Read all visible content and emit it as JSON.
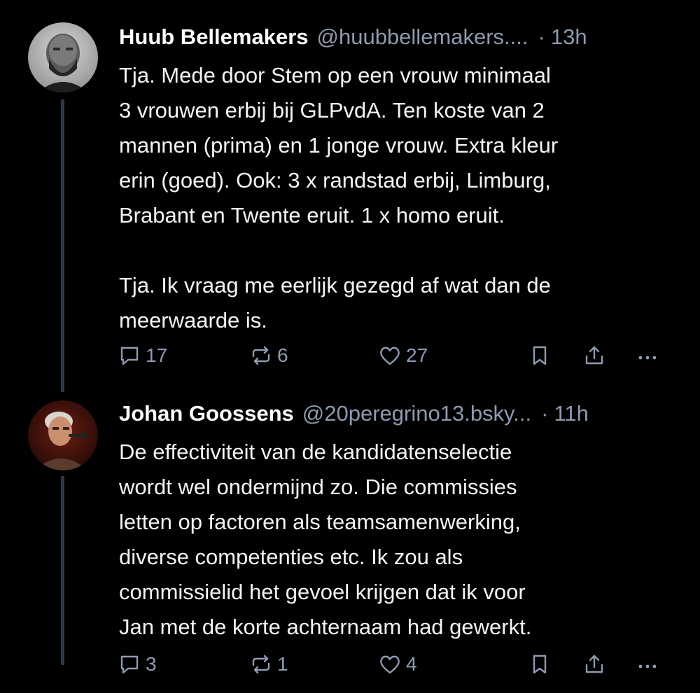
{
  "posts": [
    {
      "author_name": "Huub Bellemakers",
      "handle": "@huubbellemakers....",
      "separator": "·",
      "time": "13h",
      "avatar_icon": "user-avatar-bearded-man",
      "paragraphs": [
        "Tja. Mede door Stem op een vrouw minimaal\n3 vrouwen erbij bij GLPvdA. Ten koste van 2\nmannen (prima) en 1 jonge vrouw.  Extra kleur\nerin (goed).  Ook: 3 x randstad erbij, Limburg,\nBrabant en Twente eruit. 1 x homo eruit.",
        "Tja. Ik vraag me eerlijk gezegd af wat dan de\nmeerwaarde is."
      ],
      "replies": "17",
      "reposts": "6",
      "likes": "27"
    },
    {
      "author_name": "Johan Goossens",
      "handle": "@20peregrino13.bsky...",
      "separator": "·",
      "time": "11h",
      "avatar_icon": "user-avatar-speaker",
      "paragraphs": [
        "De effectiviteit van de kandidatenselectie\nwordt wel ondermijnd zo. Die commissies\nletten op factoren als teamsamenwerking,\ndiverse competenties etc. Ik zou als\ncommissielid het gevoel krijgen dat ik voor\nJan met de korte achternaam had gewerkt."
      ],
      "replies": "3",
      "reposts": "1",
      "likes": "4"
    }
  ],
  "icons": {
    "reply": "speech-bubble-icon",
    "repost": "repost-arrows-icon",
    "like": "heart-icon",
    "bookmark": "bookmark-icon",
    "share": "share-upload-icon",
    "more": "ellipsis-icon"
  },
  "colors": {
    "background": "#000000",
    "text": "#f2f4f7",
    "muted": "#8e9bb0",
    "thread_line": "#2c3a4f"
  }
}
